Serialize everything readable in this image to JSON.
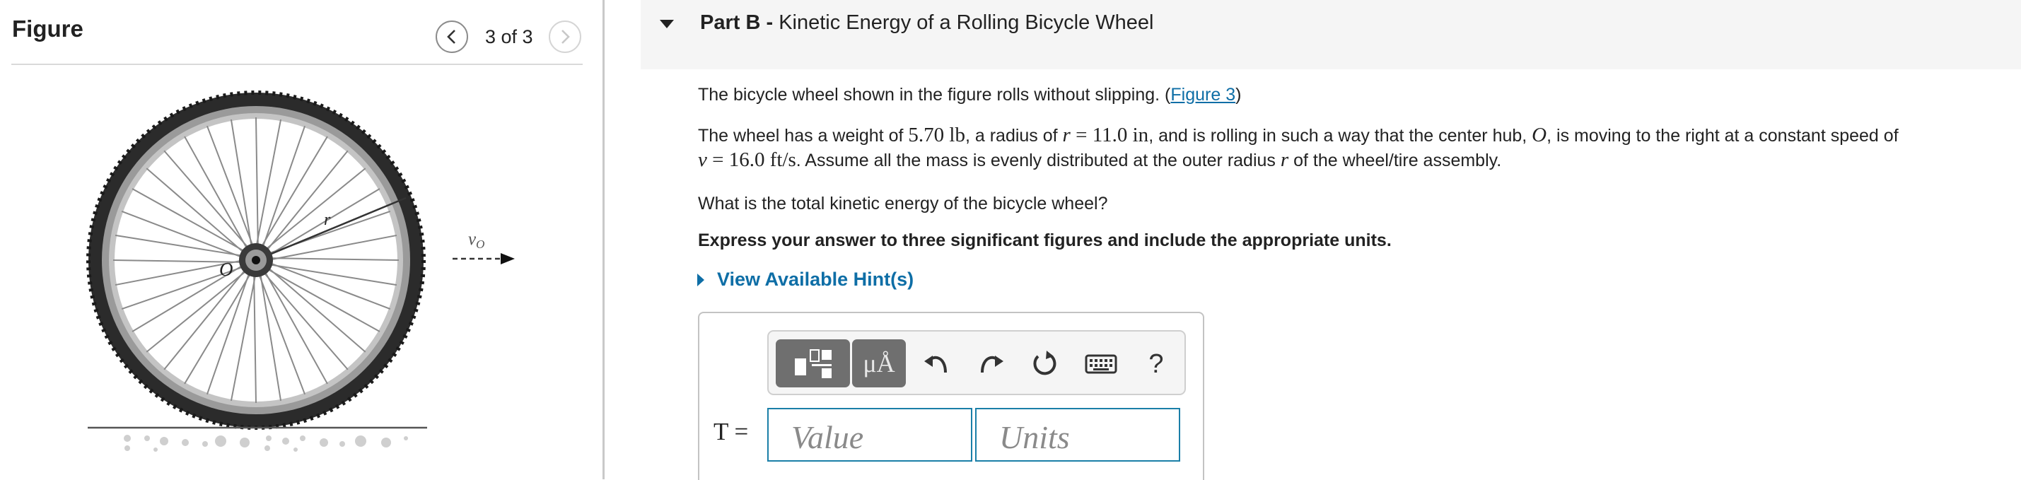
{
  "figure": {
    "title": "Figure",
    "page_label": "3 of 3",
    "hub_label": "O",
    "radius_label": "r",
    "velocity_label": "v",
    "velocity_subscript": "O"
  },
  "part": {
    "prefix": "Part B -",
    "title": "Kinetic Energy of a Rolling Bicycle Wheel"
  },
  "question": {
    "intro_text": "The bicycle wheel shown in the figure rolls without slipping. (",
    "figure_link": "Figure 3",
    "intro_end": ")",
    "line2_a": "The wheel has a weight of ",
    "weight_value": "5.70 lb",
    "line2_b": ", a radius of ",
    "radius_var": "r",
    "radius_eq": " = 11.0 in",
    "line2_c": ", and is rolling in such a way that the center hub, ",
    "hub_var": "O",
    "line2_d": ", is moving to the right at a constant speed of",
    "speed_var": "v",
    "speed_eq": " = 16.0 ft/s",
    "line3_a": ". Assume all the mass is evenly distributed at the outer radius ",
    "line3_var": "r",
    "line3_b": " of the wheel/tire assembly.",
    "prompt": "What is the total kinetic energy of the bicycle wheel?",
    "instruction": "Express your answer to three significant figures and include the appropriate units."
  },
  "hints": {
    "label": "View Available Hint(s)"
  },
  "answer": {
    "variable_label": "T =",
    "value_placeholder": "Value",
    "units_placeholder": "Units",
    "units_button_label": "μÅ",
    "help_label": "?"
  }
}
